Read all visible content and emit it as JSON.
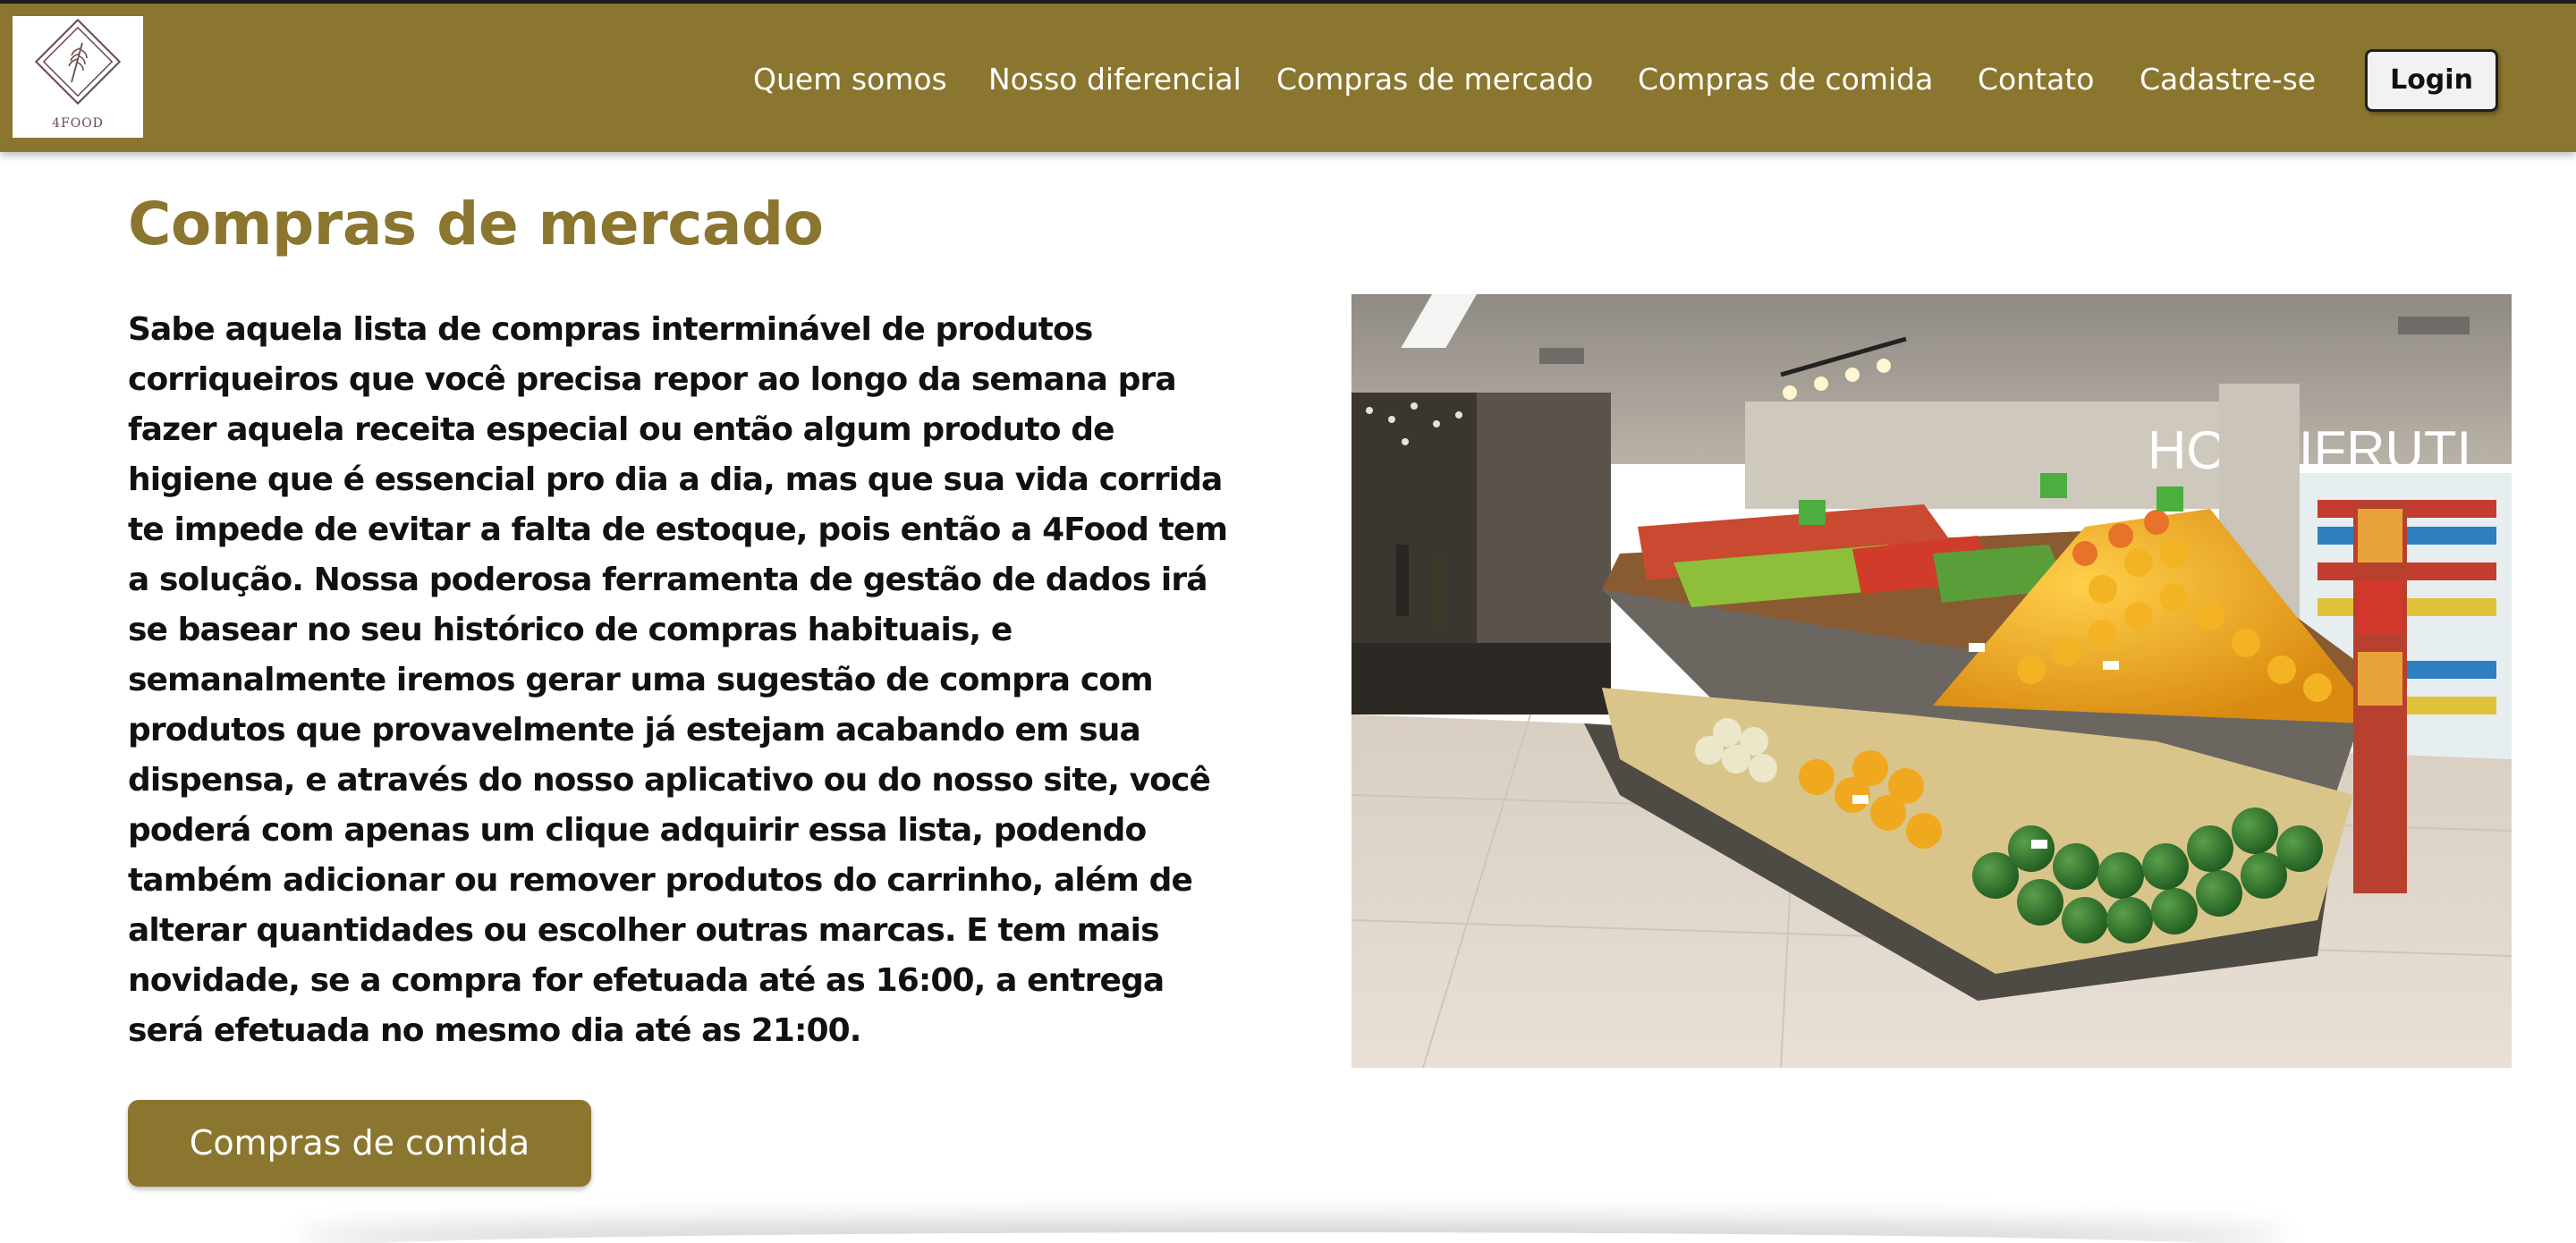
{
  "brand": {
    "logo_text": "4FOOD",
    "accent_color": "#8b762f"
  },
  "nav": {
    "items": [
      {
        "label": "Quem somos"
      },
      {
        "label": "Nosso diferencial"
      },
      {
        "label": "Compras de mercado"
      },
      {
        "label": "Compras de comida"
      },
      {
        "label": "Contato"
      },
      {
        "label": "Cadastre-se"
      }
    ],
    "login_label": "Login"
  },
  "main": {
    "title": "Compras de mercado",
    "description": "Sabe aquela lista de compras interminável de produtos corriqueiros que você precisa repor ao longo da semana pra fazer aquela receita especial ou então algum produto de higiene que é essencial pro dia a dia, mas que sua vida corrida te impede de evitar a falta de estoque, pois então a 4Food tem a solução. Nossa poderosa ferramenta de gestão de dados irá se basear no seu histórico de compras habituais, e semanalmente iremos gerar uma sugestão de compra com produtos que provavelmente já estejam acabando em sua dispensa, e através do nosso aplicativo ou do nosso site, você poderá com apenas um clique adquirir essa lista, podendo também adicionar ou remover produtos do carrinho, além de alterar quantidades ou escolher outras marcas. E tem mais novidade, se a compra for efetuada até as 16:00, a entrega será efetuada no mesmo dia até as 21:00.",
    "photo_sign": "HORTIFRUTI",
    "cta_label": "Compras de comida"
  }
}
